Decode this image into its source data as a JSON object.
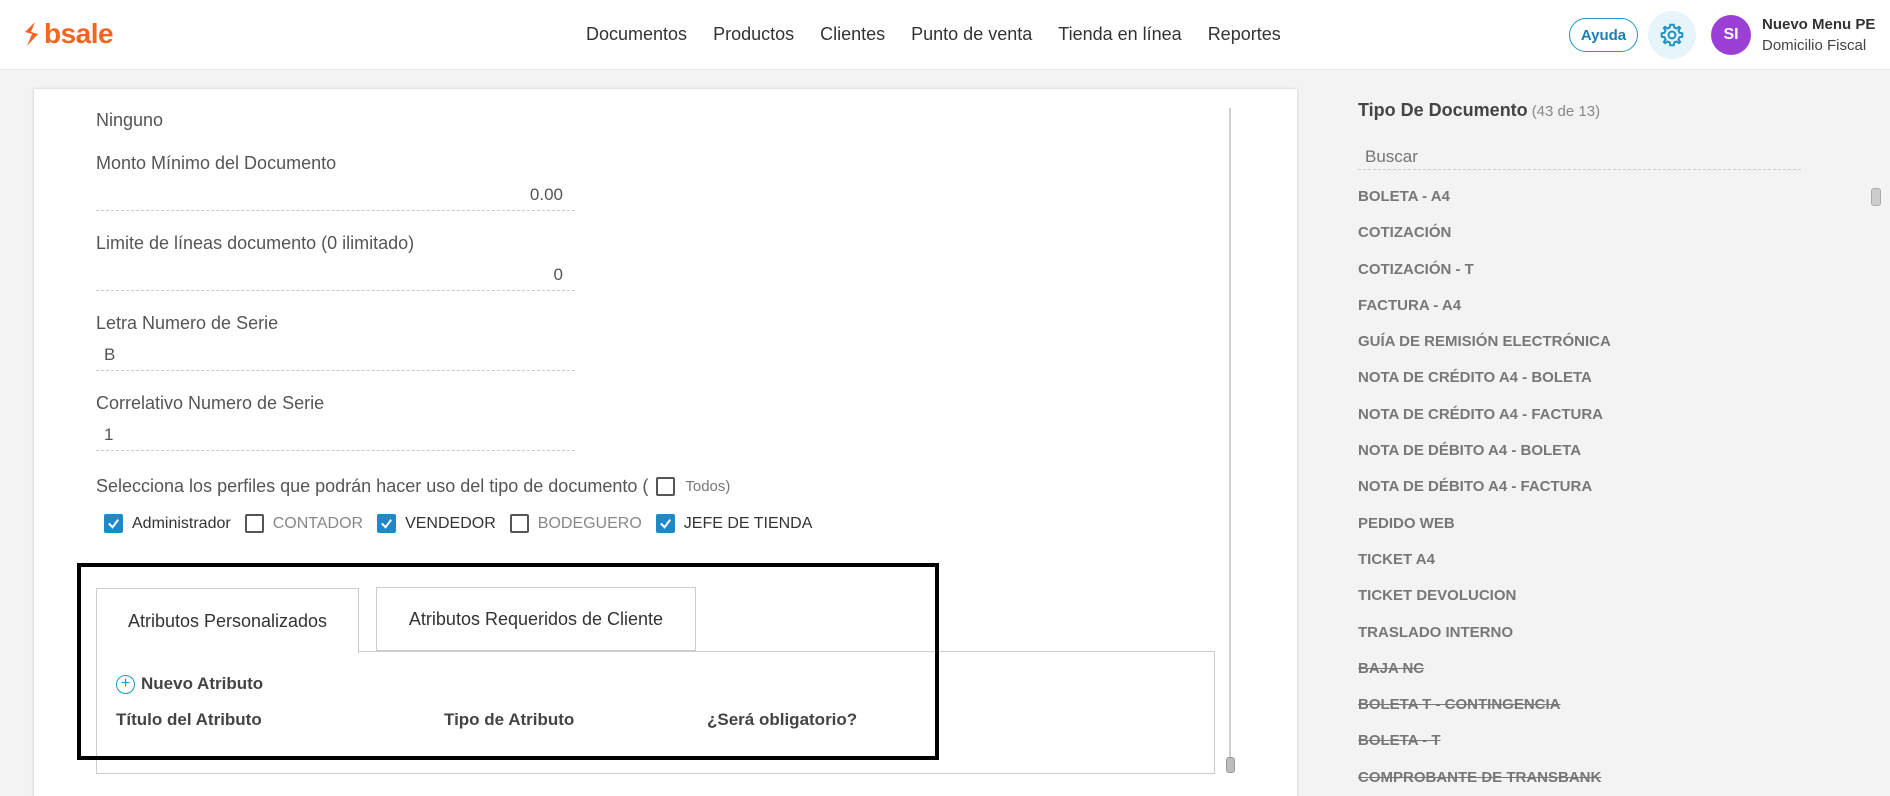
{
  "header": {
    "logo_text": "bsale",
    "nav": [
      "Documentos",
      "Productos",
      "Clientes",
      "Punto de venta",
      "Tienda en línea",
      "Reportes"
    ],
    "help_label": "Ayuda",
    "settings_icon": "gear-icon",
    "avatar_initials": "SI",
    "user_name": "Nuevo Menu PE",
    "user_subtitle": "Domicilio Fiscal",
    "colors": {
      "brand": "#f26522",
      "accent": "#1c9bc6",
      "avatar": "#9b3fd6"
    }
  },
  "form": {
    "top_value": "Ninguno",
    "min_amount": {
      "label": "Monto Mínimo del Documento",
      "value": "0.00"
    },
    "line_limit": {
      "label": "Limite de líneas documento (0 ilimitado)",
      "value": "0"
    },
    "serie_letter": {
      "label": "Letra Numero de Serie",
      "value": "B"
    },
    "serie_number": {
      "label": "Correlativo Numero de Serie",
      "value": "1"
    },
    "profiles": {
      "prompt": "Selecciona los perfiles que podrán hacer uso del tipo de documento (",
      "all_label": "Todos)",
      "all_checked": false,
      "options": [
        {
          "label": "Administrador",
          "checked": true
        },
        {
          "label": "CONTADOR",
          "checked": false
        },
        {
          "label": "VENDEDOR",
          "checked": true
        },
        {
          "label": "BODEGUERO",
          "checked": false
        },
        {
          "label": "JEFE DE TIENDA",
          "checked": true
        }
      ]
    },
    "tabs": [
      {
        "label": "Atributos Personalizados",
        "active": true
      },
      {
        "label": "Atributos Requeridos de Cliente",
        "active": false
      }
    ],
    "new_attribute_label": "Nuevo Atributo",
    "attribute_columns": [
      "Título del Atributo",
      "Tipo de Atributo",
      "¿Será obligatorio?"
    ]
  },
  "sidebar": {
    "title": "Tipo De Documento",
    "count": "(43 de 13)",
    "search_placeholder": "Buscar",
    "items": [
      {
        "label": "BOLETA - A4",
        "strike": false
      },
      {
        "label": "COTIZACIÓN",
        "strike": false
      },
      {
        "label": "COTIZACIÓN - T",
        "strike": false
      },
      {
        "label": "FACTURA - A4",
        "strike": false
      },
      {
        "label": "GUÍA DE REMISIÓN ELECTRÓNICA",
        "strike": false
      },
      {
        "label": "NOTA DE CRÉDITO A4 - BOLETA",
        "strike": false
      },
      {
        "label": "NOTA DE CRÉDITO A4 - FACTURA",
        "strike": false
      },
      {
        "label": "NOTA DE DÉBITO A4 - BOLETA",
        "strike": false
      },
      {
        "label": "NOTA DE DÉBITO A4 - FACTURA",
        "strike": false
      },
      {
        "label": "PEDIDO WEB",
        "strike": false
      },
      {
        "label": "TICKET A4",
        "strike": false
      },
      {
        "label": "TICKET DEVOLUCION",
        "strike": false
      },
      {
        "label": "TRASLADO INTERNO",
        "strike": false
      },
      {
        "label": "BAJA NC",
        "strike": true
      },
      {
        "label": "BOLETA T - CONTINGENCIA",
        "strike": true
      },
      {
        "label": "BOLETA - T",
        "strike": true
      },
      {
        "label": "COMPROBANTE DE TRANSBANK",
        "strike": true
      }
    ]
  }
}
